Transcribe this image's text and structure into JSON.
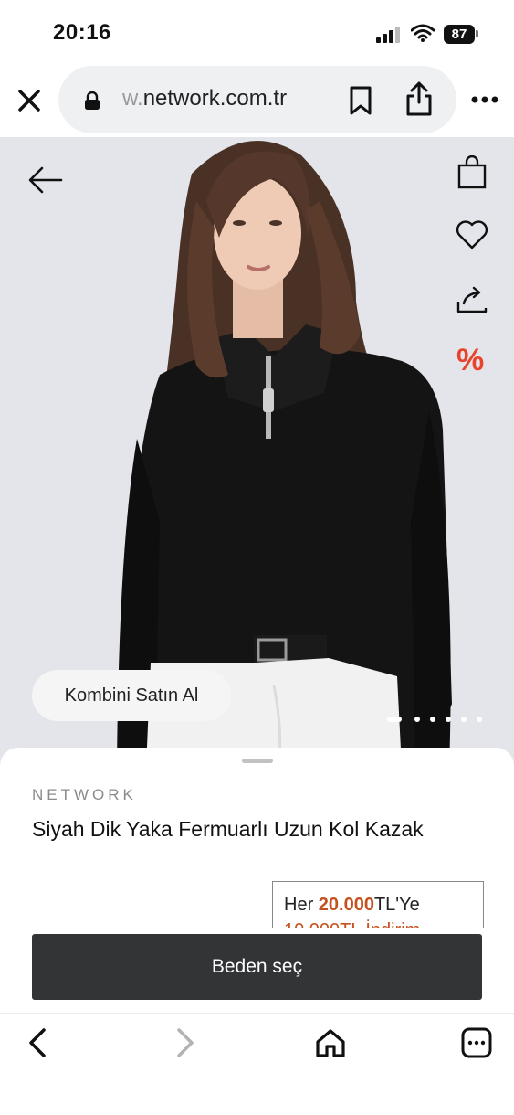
{
  "status_bar": {
    "time": "20:16",
    "battery": "87"
  },
  "browser": {
    "url_prefix": "w.",
    "url_main": "network.com.tr"
  },
  "hero": {
    "combo_button": "Kombini Satın Al",
    "promo_icon": "%",
    "image_count": 6,
    "active_image": 1
  },
  "product": {
    "brand": "NETWORK",
    "title": "Siyah Dik Yaka Fermuarlı Uzun Kol Kazak",
    "promo_prefix": "Her ",
    "promo_amount": "20.000",
    "promo_suffix": "TL'Ye",
    "promo_line2": "10.000TL İndirim",
    "cta_label": "Beden seç"
  },
  "colors": {
    "accent": "#e8442c",
    "promo": "#c4511e",
    "cta_bg": "#333436"
  },
  "icons": {
    "top_right": [
      "shopping-bag-icon",
      "heart-icon",
      "share-icon",
      "percent-icon"
    ],
    "toolbar": [
      "back-icon",
      "forward-icon",
      "home-icon",
      "tabs-icon"
    ]
  }
}
